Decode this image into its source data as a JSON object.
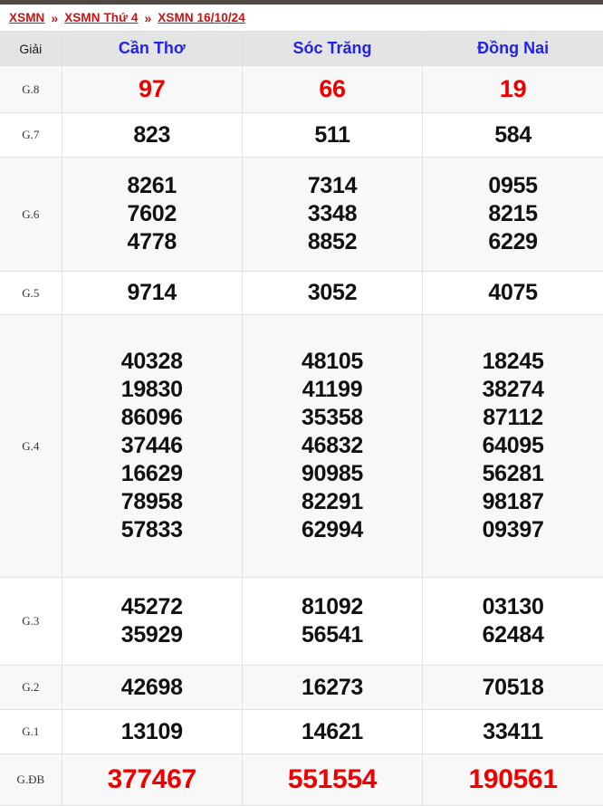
{
  "breadcrumb": {
    "separator": "»",
    "items": [
      "XSMN",
      "XSMN Thứ 4",
      "XSMN 16/10/24"
    ]
  },
  "colors": {
    "breadcrumb_text": "#cc1111",
    "province_header": "#2222ee",
    "highlight_number": "#ee0000",
    "number": "#111111",
    "header_background": "#e4e4e4",
    "row_alt_background": "#f8f8f8",
    "top_bar": "#504845"
  },
  "table": {
    "headers": {
      "prize_label": "Giải",
      "provinces": [
        "Cần Thơ",
        "Sóc Trăng",
        "Đồng Nai"
      ]
    },
    "rows": [
      {
        "label": "G.8",
        "highlight": true,
        "cells": [
          [
            "97"
          ],
          [
            "66"
          ],
          [
            "19"
          ]
        ]
      },
      {
        "label": "G.7",
        "highlight": false,
        "cells": [
          [
            "823"
          ],
          [
            "511"
          ],
          [
            "584"
          ]
        ]
      },
      {
        "label": "G.6",
        "highlight": false,
        "cells": [
          [
            "8261",
            "7602",
            "4778"
          ],
          [
            "7314",
            "3348",
            "8852"
          ],
          [
            "0955",
            "8215",
            "6229"
          ]
        ]
      },
      {
        "label": "G.5",
        "highlight": false,
        "cells": [
          [
            "9714"
          ],
          [
            "3052"
          ],
          [
            "4075"
          ]
        ]
      },
      {
        "label": "G.4",
        "highlight": false,
        "cells": [
          [
            "40328",
            "19830",
            "86096",
            "37446",
            "16629",
            "78958",
            "57833"
          ],
          [
            "48105",
            "41199",
            "35358",
            "46832",
            "90985",
            "82291",
            "62994"
          ],
          [
            "18245",
            "38274",
            "87112",
            "64095",
            "56281",
            "98187",
            "09397"
          ]
        ]
      },
      {
        "label": "G.3",
        "highlight": false,
        "cells": [
          [
            "45272",
            "35929"
          ],
          [
            "81092",
            "56541"
          ],
          [
            "03130",
            "62484"
          ]
        ]
      },
      {
        "label": "G.2",
        "highlight": false,
        "cells": [
          [
            "42698"
          ],
          [
            "16273"
          ],
          [
            "70518"
          ]
        ]
      },
      {
        "label": "G.1",
        "highlight": false,
        "cells": [
          [
            "13109"
          ],
          [
            "14621"
          ],
          [
            "33411"
          ]
        ]
      },
      {
        "label": "G.ĐB",
        "highlight": true,
        "cells": [
          [
            "377467"
          ],
          [
            "551554"
          ],
          [
            "190561"
          ]
        ]
      }
    ]
  }
}
